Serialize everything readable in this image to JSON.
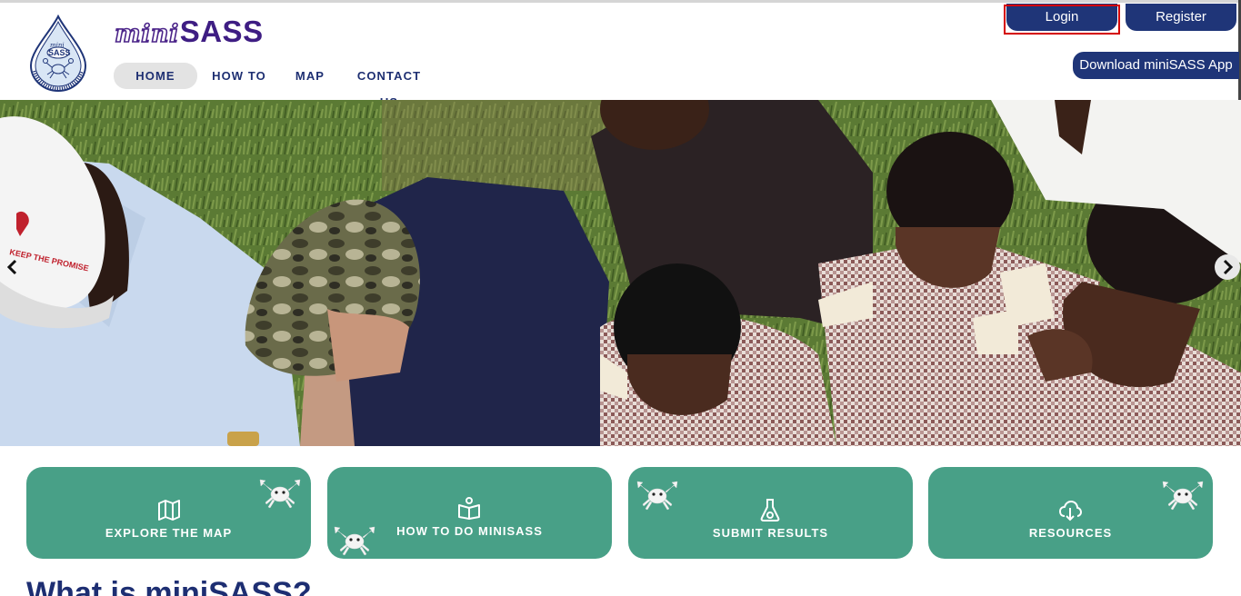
{
  "header": {
    "brand_mini": "mini",
    "brand_sass": "SASS",
    "logo_text": "mini SASS",
    "nav": {
      "home": "HOME",
      "how_to": "HOW TO",
      "map": "MAP",
      "contact": "CONTACT US"
    },
    "login_label": "Login",
    "register_label": "Register",
    "app_label": "Download miniSASS App"
  },
  "hero": {
    "cap_text": "KEEP THE PROMISE",
    "prev_icon": "chevron-left-icon",
    "next_icon": "chevron-right-icon"
  },
  "cards": [
    {
      "label": "EXPLORE THE MAP",
      "icon": "map-icon"
    },
    {
      "label": "HOW TO DO MINISASS",
      "icon": "book-reader-icon"
    },
    {
      "label": "SUBMIT RESULTS",
      "icon": "flask-icon"
    },
    {
      "label": "RESOURCES",
      "icon": "cloud-download-icon"
    }
  ],
  "section": {
    "heading": "What is miniSASS?"
  },
  "colors": {
    "navy": "#1f3578",
    "purple": "#3e1d83",
    "teal": "#48a087",
    "highlight": "#d40000"
  }
}
